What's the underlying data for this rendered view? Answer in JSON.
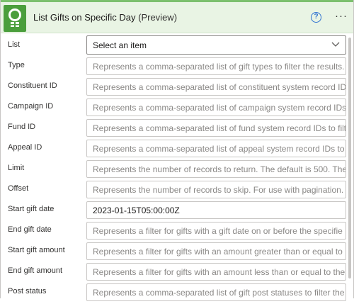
{
  "header": {
    "title": "List Gifts on Specific Day",
    "preview": "(Preview)",
    "help_icon": "help-circle-icon",
    "more_icon": "more-options-icon",
    "help_glyph": "?",
    "more_glyph": "···",
    "accent": "#4a9e3c",
    "background": "#e9f4e4"
  },
  "fields": [
    {
      "label": "List",
      "value": "Select an item",
      "kind": "select"
    },
    {
      "label": "Type",
      "placeholder": "Represents a comma-separated list of gift types to filter the results."
    },
    {
      "label": "Constituent ID",
      "placeholder": "Represents a comma-separated list of constituent system record IDs"
    },
    {
      "label": "Campaign ID",
      "placeholder": "Represents a comma-separated list of campaign system record IDs t"
    },
    {
      "label": "Fund ID",
      "placeholder": "Represents a comma-separated list of fund system record IDs to filte"
    },
    {
      "label": "Appeal ID",
      "placeholder": "Represents a comma-separated list of appeal system record IDs to f"
    },
    {
      "label": "Limit",
      "placeholder": "Represents the number of records to return. The default is 500. The"
    },
    {
      "label": "Offset",
      "placeholder": "Represents the number of records to skip. For use with pagination."
    },
    {
      "label": "Start gift date",
      "value": "2023-01-15T05:00:00Z",
      "kind": "filled"
    },
    {
      "label": "End gift date",
      "placeholder": "Represents a filter for gifts with a gift date on or before the specifie"
    },
    {
      "label": "Start gift amount",
      "placeholder": "Represents a filter for gifts with an amount greater than or equal to"
    },
    {
      "label": "End gift amount",
      "placeholder": "Represents a filter for gifts with an amount less than or equal to the"
    },
    {
      "label": "Post status",
      "placeholder": "Represents a comma-separated list of gift post statuses to filter the"
    }
  ]
}
